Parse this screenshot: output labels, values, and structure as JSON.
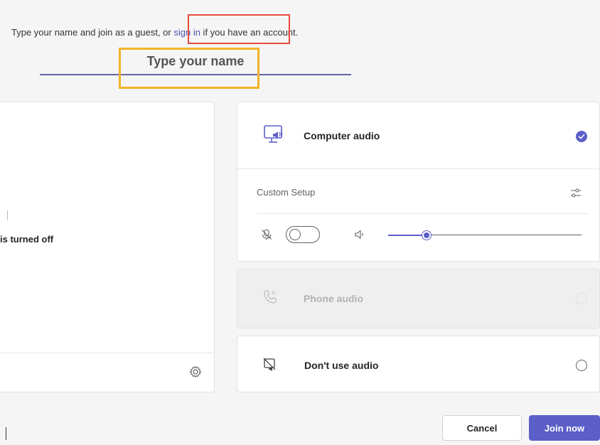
{
  "prompt": {
    "before_link": "Type your name and join as a guest, or ",
    "link_text": "sign in",
    "after_link": " if you have an account."
  },
  "name_field": {
    "placeholder": "Type your name",
    "value": ""
  },
  "preview": {
    "camera_status": "is turned off",
    "settings_icon": "gear-icon"
  },
  "audio": {
    "computer": {
      "label": "Computer audio",
      "icon": "computer-audio-icon",
      "selected": true
    },
    "custom_setup": {
      "label": "Custom Setup",
      "settings_icon": "sliders-icon",
      "mic_muted": true,
      "mic_icon": "mic-off-icon",
      "speaker_icon": "speaker-icon",
      "volume": 0.2
    },
    "phone": {
      "label": "Phone audio",
      "icon": "phone-audio-icon",
      "selected": false,
      "disabled": true
    },
    "none": {
      "label": "Don't use audio",
      "icon": "no-audio-icon",
      "selected": false
    }
  },
  "buttons": {
    "cancel": "Cancel",
    "join": "Join now"
  },
  "colors": {
    "accent": "#5b5fc7",
    "link": "#4f52b2",
    "annotation_red": "#e74c3c",
    "annotation_orange": "#f0b429"
  }
}
